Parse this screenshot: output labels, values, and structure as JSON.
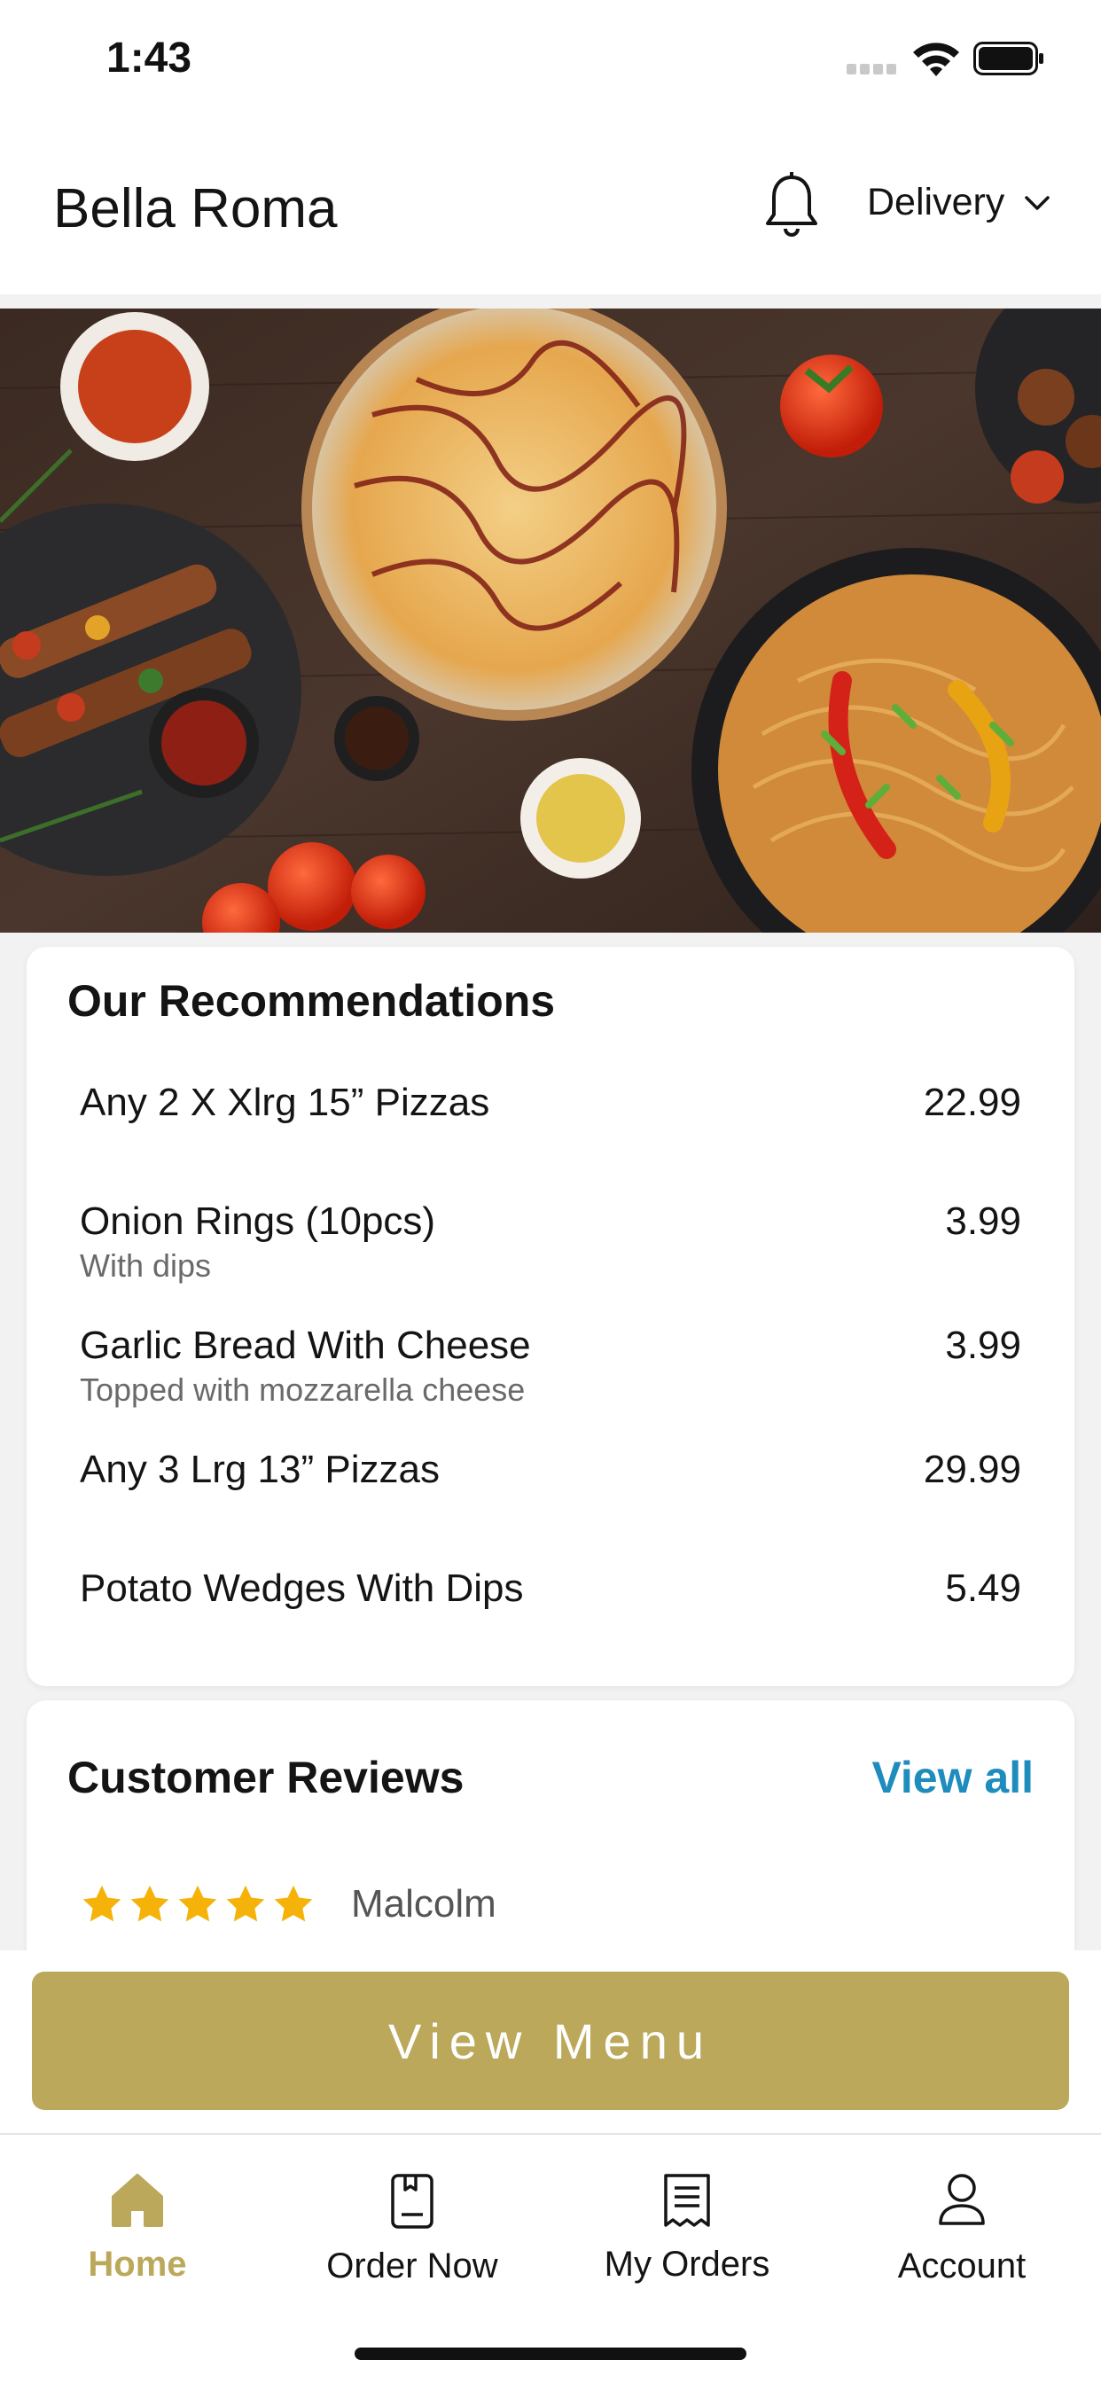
{
  "status_bar": {
    "time": "1:43",
    "icons": [
      "signal-icon",
      "wifi-icon",
      "battery-icon"
    ]
  },
  "header": {
    "title": "Bella Roma",
    "bell_icon": "bell-icon",
    "delivery_label": "Delivery",
    "chevron_icon": "chevron-down-icon"
  },
  "hero": {
    "image": "food-banner-photo"
  },
  "recommendations": {
    "title": "Our Recommendations",
    "items": [
      {
        "name": "Any 2 X Xlrg 15” Pizzas",
        "description": "",
        "price": "22.99"
      },
      {
        "name": "Onion Rings (10pcs)",
        "description": "With dips",
        "price": "3.99"
      },
      {
        "name": "Garlic Bread With Cheese",
        "description": "Topped with mozzarella cheese",
        "price": "3.99"
      },
      {
        "name": "Any 3 Lrg 13” Pizzas",
        "description": "",
        "price": "29.99"
      },
      {
        "name": "Potato Wedges With Dips",
        "description": "",
        "price": "5.49"
      }
    ]
  },
  "reviews": {
    "title": "Customer Reviews",
    "view_all": "View all",
    "first_review": {
      "stars": 5,
      "name": "Malcolm"
    }
  },
  "view_menu_button": "View Menu",
  "tabs": [
    {
      "label": "Home",
      "icon": "home-icon",
      "active": true
    },
    {
      "label": "Order Now",
      "icon": "order-icon",
      "active": false
    },
    {
      "label": "My Orders",
      "icon": "receipt-icon",
      "active": false
    },
    {
      "label": "Account",
      "icon": "user-icon",
      "active": false
    }
  ],
  "colors": {
    "accent": "#bba85a",
    "link": "#1e8dbd",
    "star": "#f5b30a",
    "background": "#f2f2f2"
  }
}
